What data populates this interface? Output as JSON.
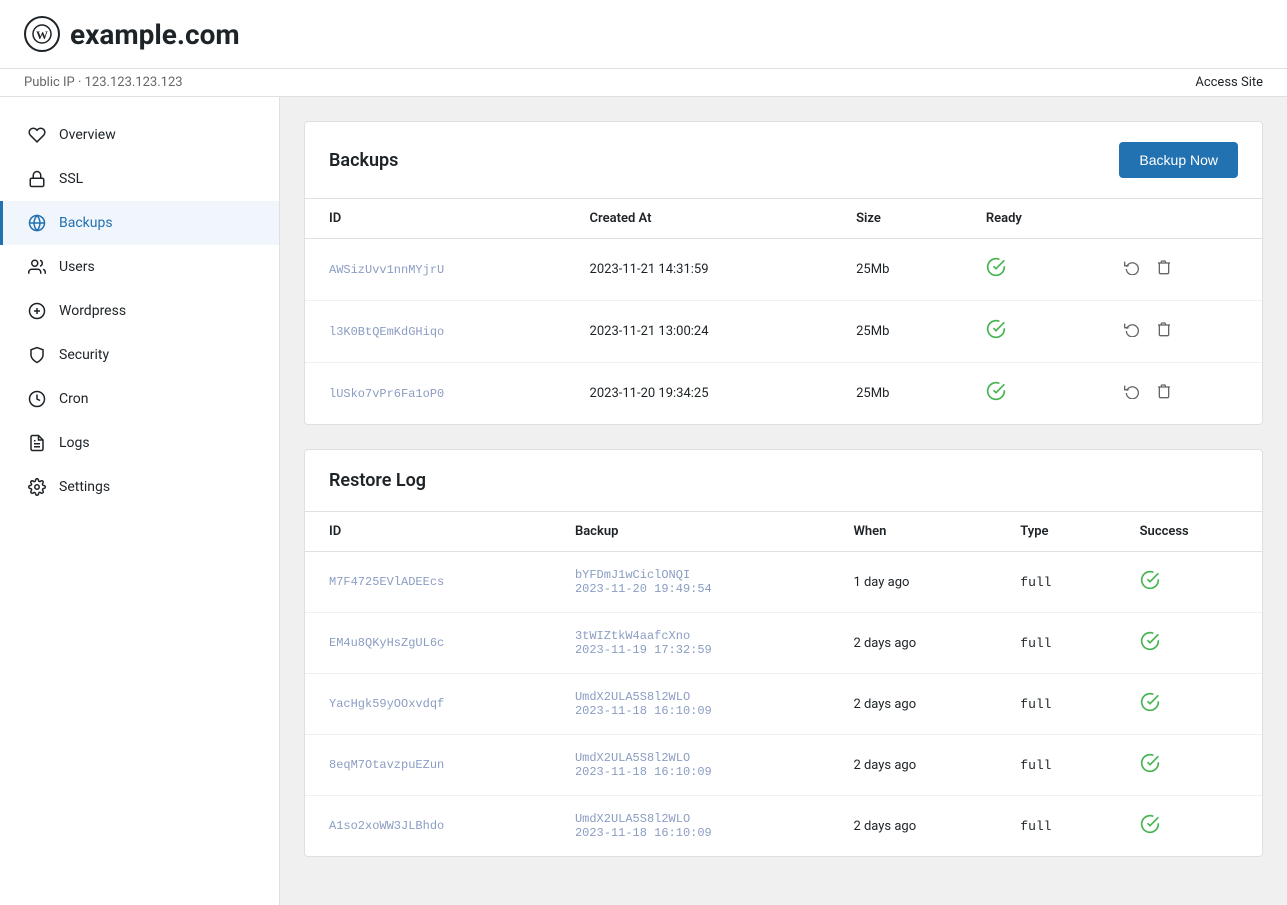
{
  "header": {
    "logo_text": "W",
    "site_title": "example.com",
    "public_ip_label": "Public IP",
    "public_ip": "123.123.123.123",
    "access_site_label": "Access Site"
  },
  "sidebar": {
    "items": [
      {
        "id": "overview",
        "label": "Overview",
        "icon": "heart"
      },
      {
        "id": "ssl",
        "label": "SSL",
        "icon": "lock"
      },
      {
        "id": "backups",
        "label": "Backups",
        "icon": "globe",
        "active": true
      },
      {
        "id": "users",
        "label": "Users",
        "icon": "users"
      },
      {
        "id": "wordpress",
        "label": "Wordpress",
        "icon": "wp"
      },
      {
        "id": "security",
        "label": "Security",
        "icon": "shield"
      },
      {
        "id": "cron",
        "label": "Cron",
        "icon": "clock"
      },
      {
        "id": "logs",
        "label": "Logs",
        "icon": "file"
      },
      {
        "id": "settings",
        "label": "Settings",
        "icon": "gear"
      }
    ]
  },
  "backups_card": {
    "title": "Backups",
    "backup_now_label": "Backup Now",
    "columns": [
      "ID",
      "Created At",
      "Size",
      "Ready"
    ],
    "rows": [
      {
        "id": "AWSizUvv1nnMYjrU",
        "created_at": "2023-11-21 14:31:59",
        "size": "25Mb",
        "ready": true
      },
      {
        "id": "l3K0BtQEmKdGHiqo",
        "created_at": "2023-11-21 13:00:24",
        "size": "25Mb",
        "ready": true
      },
      {
        "id": "lUSko7vPr6Fa1oP0",
        "created_at": "2023-11-20 19:34:25",
        "size": "25Mb",
        "ready": true
      }
    ]
  },
  "restore_log_card": {
    "title": "Restore Log",
    "columns": [
      "ID",
      "Backup",
      "When",
      "Type",
      "Success"
    ],
    "rows": [
      {
        "id": "M7F4725EVlADEEcs",
        "backup_id": "bYFDmJ1wCiclONQI",
        "backup_date": "2023-11-20 19:49:54",
        "when": "1 day ago",
        "type": "full",
        "success": true
      },
      {
        "id": "EM4u8QKyHsZgUL6c",
        "backup_id": "3tWIZtkW4aafcXno",
        "backup_date": "2023-11-19 17:32:59",
        "when": "2 days ago",
        "type": "full",
        "success": true
      },
      {
        "id": "YacHgk59yOOxvdqf",
        "backup_id": "UmdX2ULA5S8l2WLO",
        "backup_date": "2023-11-18 16:10:09",
        "when": "2 days ago",
        "type": "full",
        "success": true
      },
      {
        "id": "8eqM7OtavzpuEZun",
        "backup_id": "UmdX2ULA5S8l2WLO",
        "backup_date": "2023-11-18 16:10:09",
        "when": "2 days ago",
        "type": "full",
        "success": true
      },
      {
        "id": "A1so2xoWW3JLBhdo",
        "backup_id": "UmdX2ULA5S8l2WLO",
        "backup_date": "2023-11-18 16:10:09",
        "when": "2 days ago",
        "type": "full",
        "success": true
      }
    ]
  }
}
